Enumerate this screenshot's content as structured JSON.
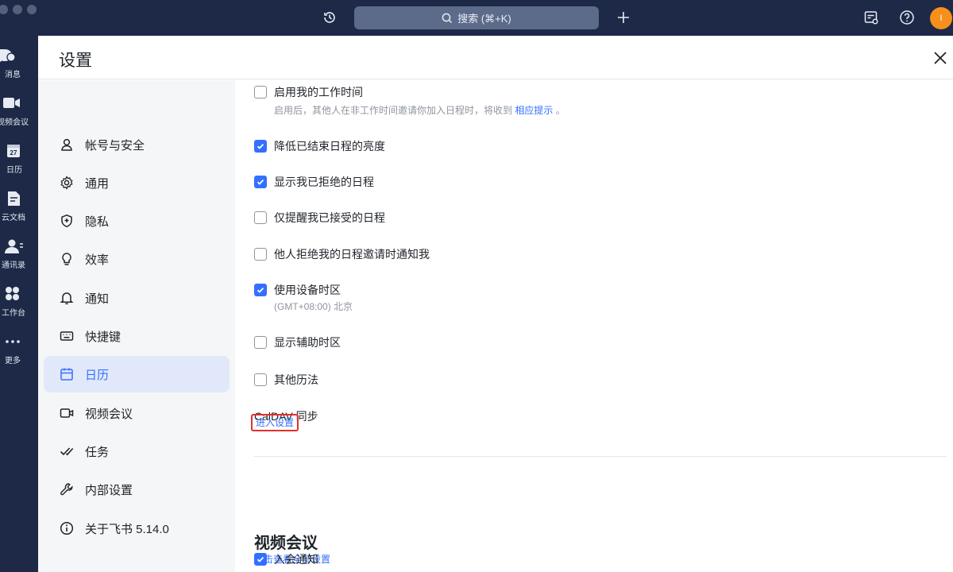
{
  "topbar": {
    "search_label": "搜索 (⌘+K)",
    "avatar_text": "I"
  },
  "rail": {
    "items": [
      {
        "label": "消息",
        "icon": "chat-bubble-icon"
      },
      {
        "label": "视频会议",
        "icon": "video-camera-icon"
      },
      {
        "label": "日历",
        "icon": "calendar-icon",
        "badge": "27"
      },
      {
        "label": "云文档",
        "icon": "cloud-doc-icon"
      },
      {
        "label": "通讯录",
        "icon": "contacts-icon"
      },
      {
        "label": "工作台",
        "icon": "workplace-icon"
      },
      {
        "label": "更多",
        "icon": "more-icon"
      }
    ]
  },
  "panel": {
    "title": "设置"
  },
  "sidenav": {
    "items": [
      {
        "label": "帐号与安全",
        "icon": "user-icon"
      },
      {
        "label": "通用",
        "icon": "gear-icon"
      },
      {
        "label": "隐私",
        "icon": "shield-icon"
      },
      {
        "label": "效率",
        "icon": "lightbulb-icon"
      },
      {
        "label": "通知",
        "icon": "bell-icon"
      },
      {
        "label": "快捷键",
        "icon": "keyboard-icon"
      },
      {
        "label": "日历",
        "icon": "calendar-icon",
        "active": true
      },
      {
        "label": "视频会议",
        "icon": "video-icon"
      },
      {
        "label": "任务",
        "icon": "task-check-icon"
      },
      {
        "label": "内部设置",
        "icon": "wrench-icon"
      },
      {
        "label": "关于飞书 5.14.0",
        "icon": "info-icon"
      }
    ]
  },
  "calendar_settings": {
    "options": [
      {
        "label": "启用我的工作时间",
        "checked": false,
        "desc_prefix": "启用后，其他人在非工作时间邀请你加入日程时，将收到",
        "desc_link": "相应提示",
        "desc_suffix": "。"
      },
      {
        "label": "降低已结束日程的亮度",
        "checked": true
      },
      {
        "label": "显示我已拒绝的日程",
        "checked": true
      },
      {
        "label": "仅提醒我已接受的日程",
        "checked": false
      },
      {
        "label": "他人拒绝我的日程邀请时通知我",
        "checked": false
      },
      {
        "label": "使用设备时区",
        "checked": true,
        "desc": "(GMT+08:00) 北京"
      },
      {
        "label": "显示辅助时区",
        "checked": false
      },
      {
        "label": "其他历法",
        "checked": false
      }
    ],
    "caldav_title": "CalDAV 同步",
    "caldav_button": "进入设置"
  },
  "video_section": {
    "title": "视频会议",
    "link": "点击查看全部设置",
    "option_label": "入会通知",
    "option_checked": true
  },
  "colors": {
    "accent": "#3370ff",
    "topbar": "#1d2947",
    "highlight_box": "#e0312a",
    "avatar": "#f6901c"
  }
}
